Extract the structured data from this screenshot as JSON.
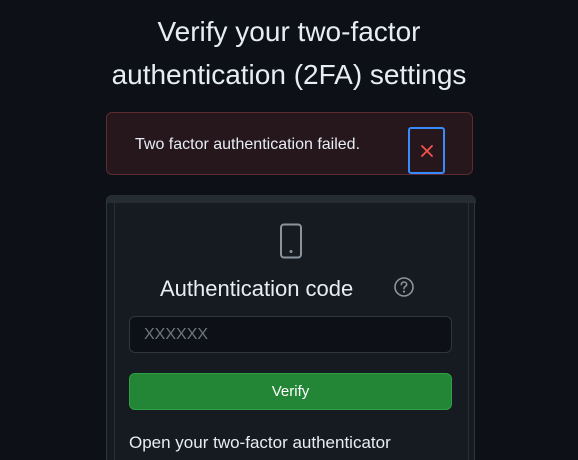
{
  "page": {
    "title": "Verify your two-factor authentication (2FA) settings"
  },
  "alert": {
    "message": "Two factor authentication failed.",
    "close_icon": "close-icon"
  },
  "auth": {
    "device_icon": "mobile-device-icon",
    "heading": "Authentication code",
    "help_icon": "question-icon",
    "input": {
      "placeholder": "XXXXXX",
      "value": ""
    },
    "verify_label": "Verify",
    "instructions": "Open your two-factor authenticator"
  },
  "colors": {
    "background": "#0d1117",
    "panel": "#161b22",
    "error_bg": "#25171c",
    "error_border": "#5d2a2d",
    "close_x": "#f85149",
    "focus_ring": "#388bfd",
    "primary_button": "#238636"
  }
}
